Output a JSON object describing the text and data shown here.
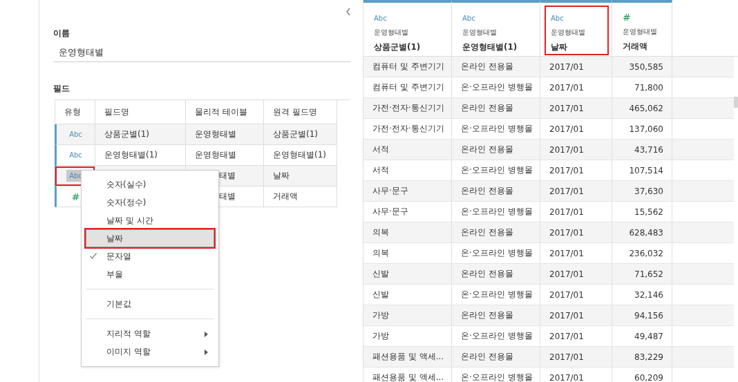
{
  "left_panel": {
    "name_label": "이름",
    "name_value": "운영형태별",
    "fields_label": "필드",
    "fields_table": {
      "columns": [
        "유형",
        "필드명",
        "물리적 테이블",
        "원격 필드명"
      ],
      "rows": [
        {
          "type": "Abc",
          "kind": "string",
          "type_active": false,
          "marked": false,
          "covered": false,
          "field_name": "상품군별(1)",
          "physical_table": "운영형태별",
          "remote_name": "상품군별(1)"
        },
        {
          "type": "Abc",
          "kind": "string",
          "type_active": false,
          "marked": false,
          "covered": false,
          "field_name": "운영형태별(1)",
          "physical_table": "운영형태별",
          "remote_name": "운영형태별(1)"
        },
        {
          "type": "Abc",
          "kind": "string",
          "type_active": true,
          "marked": true,
          "covered": true,
          "physical_table": "태별",
          "remote_name": "날짜"
        },
        {
          "type": "#",
          "kind": "number",
          "type_active": false,
          "marked": false,
          "covered": true,
          "physical_table": "태별",
          "remote_name": "거래액"
        }
      ]
    },
    "type_menu": {
      "items": [
        {
          "kind": "item",
          "label": "숫자(실수)",
          "checked": false,
          "selected": false,
          "marked": false
        },
        {
          "kind": "item",
          "label": "숫자(정수)",
          "checked": false,
          "selected": false,
          "marked": false
        },
        {
          "kind": "item",
          "label": "날짜 및 시간",
          "checked": false,
          "selected": false,
          "marked": false
        },
        {
          "kind": "item",
          "label": "날짜",
          "checked": false,
          "selected": true,
          "marked": true
        },
        {
          "kind": "item",
          "label": "문자열",
          "checked": true,
          "selected": false,
          "marked": false
        },
        {
          "kind": "item",
          "label": "부울",
          "checked": false,
          "selected": false,
          "marked": false
        },
        {
          "kind": "divider"
        },
        {
          "kind": "item",
          "label": "기본값",
          "checked": false,
          "selected": false,
          "marked": false
        },
        {
          "kind": "divider"
        },
        {
          "kind": "submenu",
          "label": "지리적 역할",
          "checked": false,
          "selected": false,
          "marked": false
        },
        {
          "kind": "submenu",
          "label": "이미지 역할",
          "checked": false,
          "selected": false,
          "marked": false
        }
      ]
    }
  },
  "data_grid": {
    "columns": [
      {
        "type": "Abc",
        "kind": "string",
        "source": "운영형태별",
        "name": "상품군별(1)",
        "marked": false
      },
      {
        "type": "Abc",
        "kind": "string",
        "source": "운영형태별",
        "name": "운영형태별(1)",
        "marked": false
      },
      {
        "type": "Abc",
        "kind": "string",
        "source": "운영형태별",
        "name": "날짜",
        "marked": true
      },
      {
        "type": "#",
        "kind": "number",
        "source": "운영형태별",
        "name": "거래액",
        "marked": false
      }
    ],
    "rows": [
      [
        "컴퓨터 및 주변기기",
        "온라인 전용몰",
        "2017/01",
        "350,585"
      ],
      [
        "컴퓨터 및 주변기기",
        "온·오프라인 병행몰",
        "2017/01",
        "71,800"
      ],
      [
        "가전·전자·통신기기",
        "온라인 전용몰",
        "2017/01",
        "465,062"
      ],
      [
        "가전·전자·통신기기",
        "온·오프라인 병행몰",
        "2017/01",
        "137,060"
      ],
      [
        "서적",
        "온라인 전용몰",
        "2017/01",
        "43,716"
      ],
      [
        "서적",
        "온·오프라인 병행몰",
        "2017/01",
        "107,514"
      ],
      [
        "사무·문구",
        "온라인 전용몰",
        "2017/01",
        "37,630"
      ],
      [
        "사무·문구",
        "온·오프라인 병행몰",
        "2017/01",
        "15,562"
      ],
      [
        "의복",
        "온라인 전용몰",
        "2017/01",
        "628,483"
      ],
      [
        "의복",
        "온·오프라인 병행몰",
        "2017/01",
        "236,032"
      ],
      [
        "신발",
        "온라인 전용몰",
        "2017/01",
        "71,652"
      ],
      [
        "신발",
        "온·오프라인 병행몰",
        "2017/01",
        "32,146"
      ],
      [
        "가방",
        "온라인 전용몰",
        "2017/01",
        "94,156"
      ],
      [
        "가방",
        "온·오프라인 병행몰",
        "2017/01",
        "49,487"
      ],
      [
        "패션용품 및 액세...",
        "온라인 전용몰",
        "2017/01",
        "83,229"
      ],
      [
        "패션용품 및 액세...",
        "온·오프라인 병행몰",
        "2017/01",
        "60,209"
      ]
    ]
  }
}
